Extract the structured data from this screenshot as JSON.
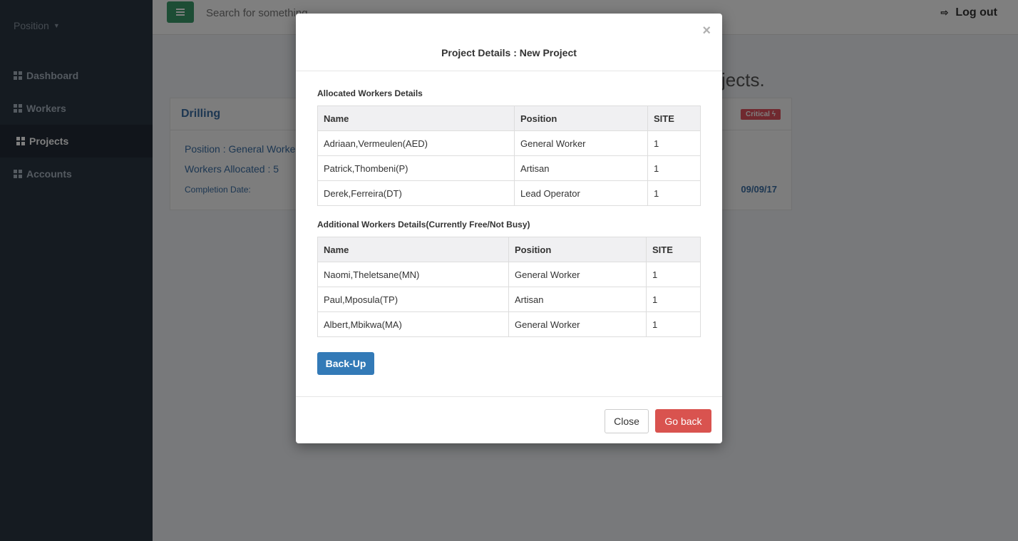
{
  "sidebar": {
    "brand": "Position",
    "items": [
      {
        "label": "Dashboard"
      },
      {
        "label": "Workers"
      },
      {
        "label": "Projects"
      },
      {
        "label": "Accounts"
      }
    ]
  },
  "topbar": {
    "search_text": "Search for something",
    "logout_label": "Log out"
  },
  "main": {
    "page_message": "jects.",
    "project": {
      "title": "Drilling",
      "badge": "Critical ϟ",
      "position": "Position : General Worker",
      "workers_allocated": "Workers Allocated : 5",
      "completion_label": "Completion Date:",
      "completion_date": "09/09/17"
    }
  },
  "modal": {
    "title": "Project Details : New Project",
    "close_symbol": "×",
    "allocated_label": "Allocated Workers Details",
    "additional_label": "Additional Workers Details(Currently Free/Not Busy)",
    "columns": [
      "Name",
      "Position",
      "SITE"
    ],
    "allocated_rows": [
      [
        "Adriaan,Vermeulen(AED)",
        "General Worker",
        "1"
      ],
      [
        "Patrick,Thombeni(P)",
        "Artisan",
        "1"
      ],
      [
        "Derek,Ferreira(DT)",
        "Lead Operator",
        "1"
      ]
    ],
    "additional_rows": [
      [
        "Naomi,Theletsane(MN)",
        "General Worker",
        "1"
      ],
      [
        "Paul,Mposula(TP)",
        "Artisan",
        "1"
      ],
      [
        "Albert,Mbikwa(MA)",
        "General Worker",
        "1"
      ]
    ],
    "backup_label": "Back-Up",
    "close_label": "Close",
    "goback_label": "Go back"
  }
}
